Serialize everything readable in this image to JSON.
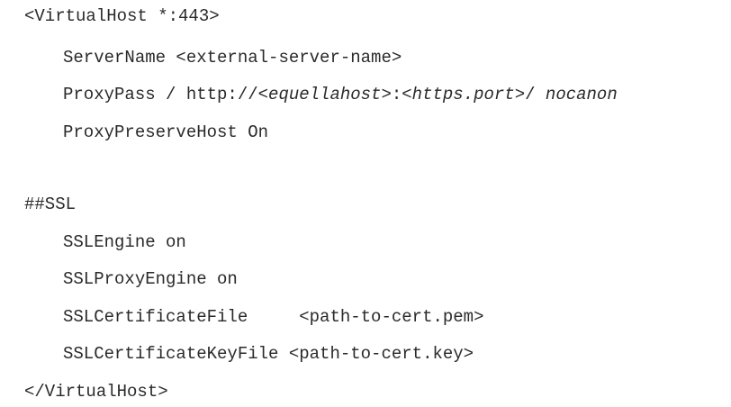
{
  "config_lines": {
    "open_tag": "<VirtualHost *:443>",
    "server_name": "ServerName <external-server-name>",
    "proxy_pass": {
      "prefix": "ProxyPass / http://",
      "host": "<equellahost>",
      "sep": ":",
      "port": "<https.port>",
      "slash": "/ ",
      "flag": "nocanon"
    },
    "proxy_preserve_host": "ProxyPreserveHost On",
    "ssl_comment": "##SSL",
    "ssl_engine": "SSLEngine on",
    "ssl_proxy_engine": "SSLProxyEngine on",
    "ssl_cert_file": "SSLCertificateFile     <path-to-cert.pem>",
    "ssl_cert_key_file": "SSLCertificateKeyFile <path-to-cert.key>",
    "close_tag": "</VirtualHost>"
  }
}
